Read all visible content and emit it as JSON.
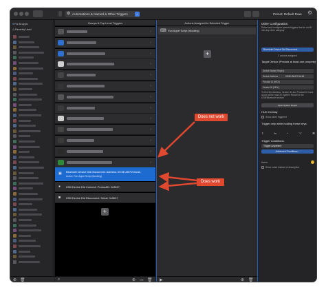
{
  "toolbar": {
    "preset_selector": "Automations & Named & Other Triggers",
    "preset_label": "Preset: Default Raw"
  },
  "sidebar": {
    "all_apps": "For All Apps",
    "recently_used": "Recently Used"
  },
  "triggers_column": {
    "header": "Groups & Top Level Triggers",
    "selected": {
      "title": "Bluetooth Device Did Disconnect: Address: 09:5E:AB:F2:0A:62,",
      "action": "Action: Run Apple Script (blocking)"
    },
    "rows": [
      {
        "label": "USB Device Did Connect: ProductID: 0x5817,"
      },
      {
        "label": "USB Device Did Disconnect: Serial: 0x5817,"
      }
    ]
  },
  "actions_column": {
    "header": "Actions Assigned to Selected Trigger",
    "action": "Run Apple Script (blocking)"
  },
  "config_panel": {
    "title": "Other Configuration",
    "desc": "Select and configure special triggers that do not fit into any other category",
    "trigger_select": "Bluetooth Device Did Disconnect",
    "actions_count": "2 actions assigned",
    "target_device_heading": "Target Device (Provide at least one property)",
    "fields": [
      {
        "label": "Device Name (Regex)",
        "value": ""
      },
      {
        "label": "Device Address",
        "value": "09:5E:AB:F2:0A:62"
      },
      {
        "label": "Product ID (HEX)",
        "value": ""
      },
      {
        "label": "Vendor ID (HEX)",
        "value": ""
      }
    ],
    "help": "To find the Address, Vendor ID and Product ID have a look at the macOS System Report in the USB/Bluetooth section",
    "system_report_button": "Open System Report",
    "hud_heading": "HUD Overlay",
    "hud_checkbox": "Show when triggered",
    "trigger_keys_heading": "Trigger only while holding these keys:",
    "trigger_conditions_heading": "Trigger Conditions:",
    "trigger_anywhere": "Trigger Anywhere",
    "advanced_conditions": "Advanced Conditions...",
    "notes_label": "Notes:",
    "notes_checkbox": "Show notes instead of description"
  },
  "annotations": {
    "does_not_work": "Does not work",
    "does_work": "Does work"
  },
  "colors": {
    "selection": "#1d6ad0",
    "annotation": "#e04830"
  }
}
